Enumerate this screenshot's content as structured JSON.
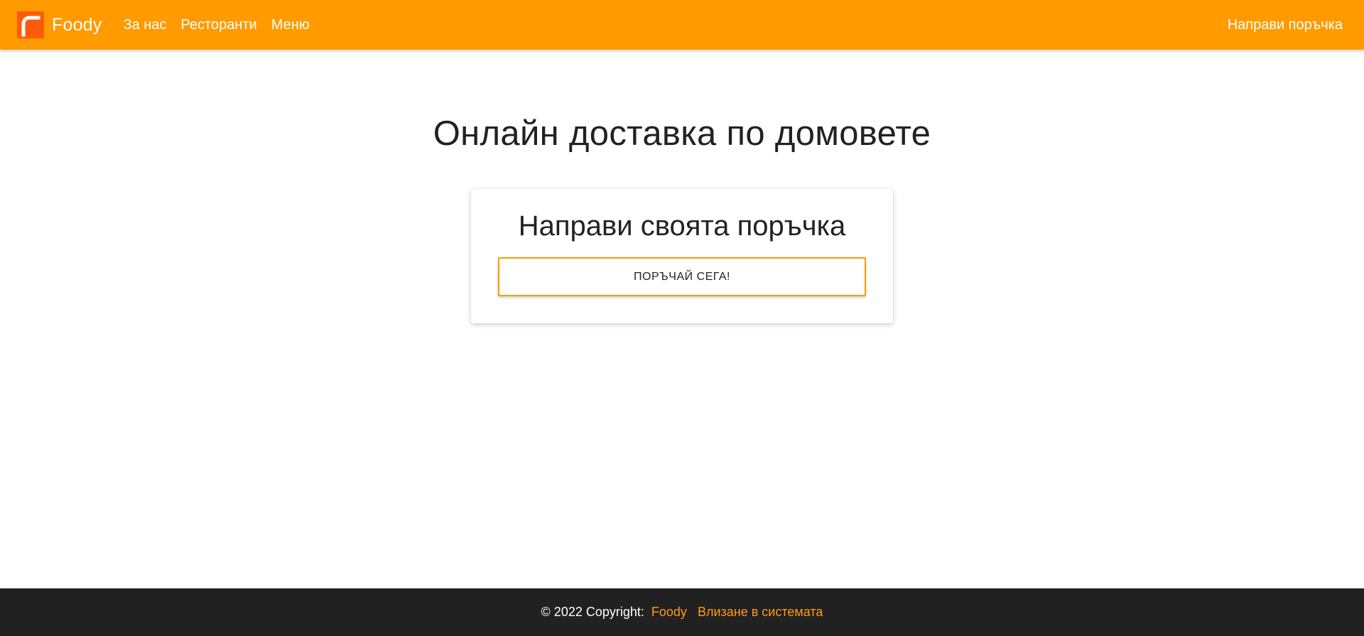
{
  "navbar": {
    "brand_name": "Foody",
    "links": [
      "За нас",
      "Ресторанти",
      "Меню"
    ],
    "right_link": "Направи поръчка",
    "logo_icon": "foody-logo-icon",
    "color": "#ff9a00"
  },
  "main": {
    "title": "Онлайн доставка по домовете",
    "card": {
      "title": "Направи своята поръчка",
      "button_label": "ПОРЪЧАЙ СЕГА!"
    }
  },
  "footer": {
    "copyright": "© 2022 Copyright:",
    "brand_link": "Foody",
    "login_link": "Влизане в системата",
    "link_color": "#ff9a1f",
    "background": "#212121"
  }
}
